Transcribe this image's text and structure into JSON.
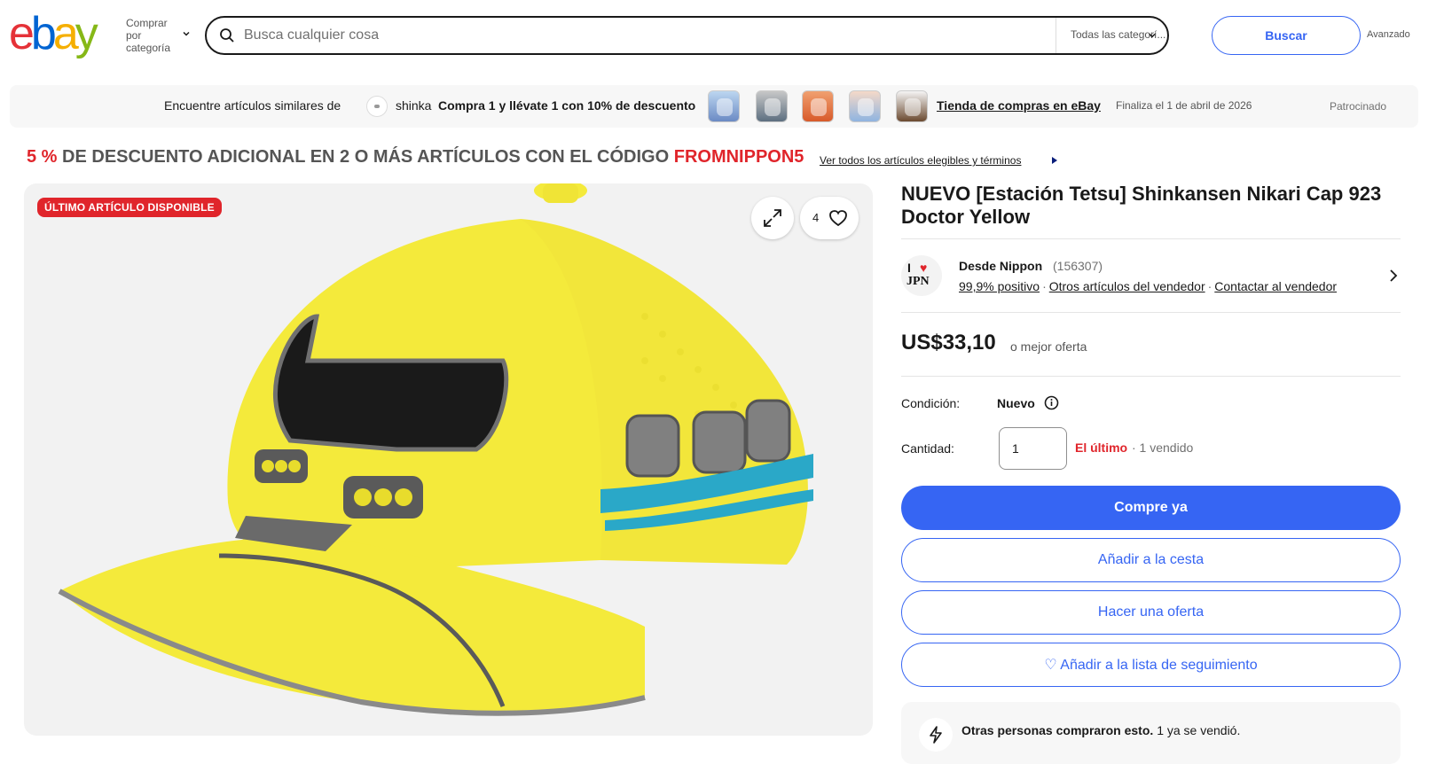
{
  "header": {
    "shop_by_category": "Comprar por categoría",
    "search_placeholder": "Busca cualquier cosa",
    "category_select": "Todas las categorí...",
    "search_button": "Buscar",
    "advanced": "Avanzado"
  },
  "banner": {
    "lead": "Encuentre artículos similares de",
    "store_name": "shinka",
    "promo": "Compra 1 y llévate 1 con 10% de descuento",
    "store_link": "Tienda de compras en eBay",
    "ends": "Finaliza el 1 de abril de 2026",
    "sponsored": "Patrocinado"
  },
  "coupon": {
    "percent": "5 %",
    "text": "DE DESCUENTO ADICIONAL EN 2 O MÁS ARTÍCULOS CON EL CÓDIGO",
    "code": "FROMNIPPON5",
    "link": "Ver todos los artículos elegibles y términos"
  },
  "image_panel": {
    "badge": "ÚLTIMO ARTÍCULO DISPONIBLE",
    "watch_count": "4"
  },
  "product": {
    "title": "NUEVO [Estación Tetsu] Shinkansen Nikari Cap 923 Doctor Yellow",
    "seller_name": "Desde Nippon",
    "seller_feedback_count": "(156307)",
    "seller_positive": "99,9% positivo",
    "seller_other_items": "Otros artículos del vendedor",
    "seller_contact": "Contactar al vendedor",
    "price": "US$33,10",
    "best_offer": "o mejor oferta",
    "condition_label": "Condición:",
    "condition_value": "Nuevo",
    "quantity_label": "Cantidad:",
    "quantity_value": "1",
    "last_one": "El último",
    "sold": "· 1 vendido"
  },
  "actions": {
    "buy_now": "Compre ya",
    "add_to_cart": "Añadir a la cesta",
    "make_offer": "Hacer una oferta",
    "add_watchlist": "♡ Añadir a la lista de seguimiento"
  },
  "others": {
    "bold": "Otras personas compraron esto.",
    "rest": "1 ya se vendió."
  },
  "colors": {
    "brand_blue": "#3665f3",
    "alert_red": "#e0252b",
    "ebay_e": "#e53238",
    "ebay_b": "#0064d2",
    "ebay_a": "#f5af02",
    "ebay_y": "#86b817"
  }
}
